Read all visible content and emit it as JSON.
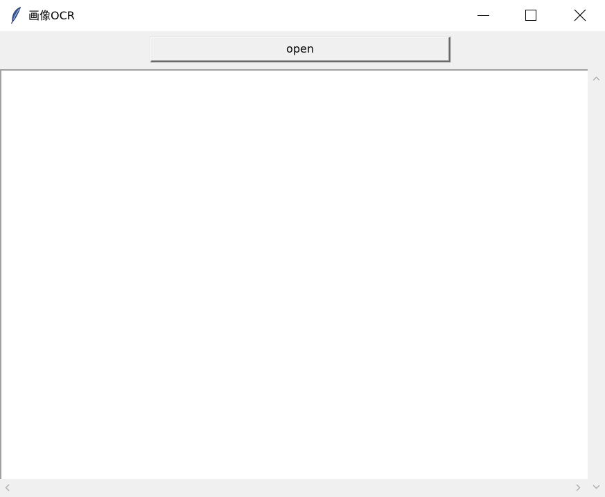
{
  "window": {
    "title": "画像OCR",
    "icon": "feather-icon",
    "controls": [
      "minimize-icon",
      "maximize-icon",
      "close-icon"
    ]
  },
  "toolbar": {
    "open_label": "open"
  },
  "text_area": {
    "content": ""
  },
  "colors": {
    "titlebar": "#ffffff",
    "client_background": "#f0f0f0",
    "text_area": "#ffffff",
    "icon_blue": "#3b5b9d"
  }
}
